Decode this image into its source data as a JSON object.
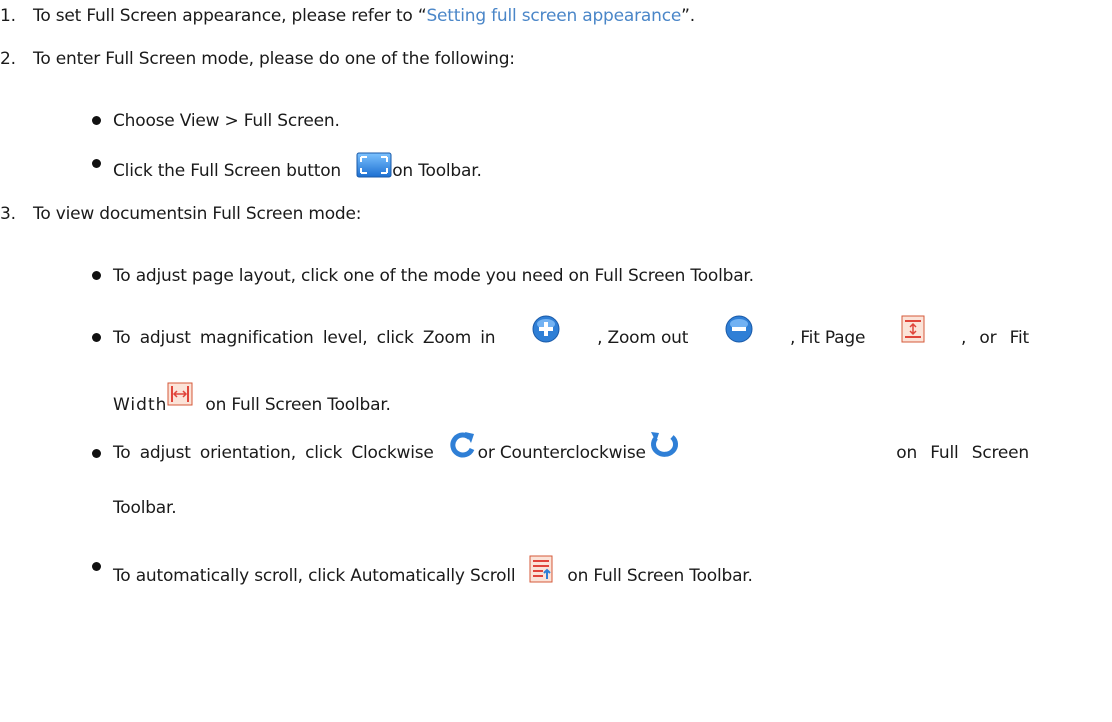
{
  "items": {
    "i1": {
      "num": "1.",
      "pre": "To set Full Screen appearance, please refer to “",
      "link": "Setting full screen appearance",
      "post": "”."
    },
    "i2": {
      "num": "2.",
      "text": "To enter Full Screen mode, please do one of the following:",
      "b1": "Choose View > Full Screen.",
      "b2_pre": "Click the Full Screen button",
      "b2_post": "on Toolbar."
    },
    "i3": {
      "num": "3.",
      "text": "To view documentsin Full Screen mode:",
      "b1": "To adjust page layout, click one of the mode you need on Full Screen Toolbar.",
      "b2_a": "To adjust magnification level, click Zoom in",
      "b2_b": ", Zoom out",
      "b2_c": ", Fit Page",
      "b2_d": ", or Fit",
      "b2_e": "Width",
      "b2_f": "on Full Screen Toolbar.",
      "b3_a": "To adjust orientation, click Clockwise",
      "b3_b": "or Counterclockwise",
      "b3_c": "on Full Screen",
      "b3_d": "Toolbar.",
      "b4_a": "To automatically scroll, click Automatically Scroll",
      "b4_b": "on Full Screen Toolbar."
    }
  },
  "icons": {
    "full_screen": "full-screen-icon",
    "zoom_in": "zoom-in-icon",
    "zoom_out": "zoom-out-icon",
    "fit_page": "fit-page-icon",
    "fit_width": "fit-width-icon",
    "clockwise": "rotate-clockwise-icon",
    "counterclockwise": "rotate-counterclockwise-icon",
    "auto_scroll": "automatically-scroll-icon"
  },
  "colors": {
    "link": "#4a86c8",
    "text": "#1a1a1a",
    "icon_blue": "#2f7fd6",
    "icon_red": "#e0443a"
  }
}
